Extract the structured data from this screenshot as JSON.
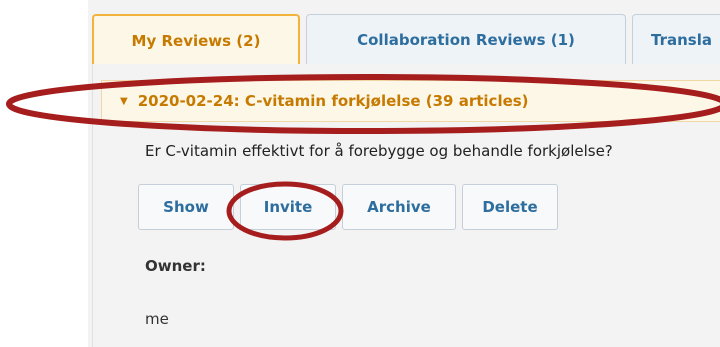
{
  "tabs": [
    {
      "label": "My Reviews (2)",
      "active": true
    },
    {
      "label": "Collaboration Reviews (1)",
      "active": false
    },
    {
      "label": "Transla",
      "active": false
    }
  ],
  "review": {
    "title": "2020-02-24: C-vitamin forkjølelse (39 articles)",
    "question": "Er C-vitamin effektivt for å forebygge og behandle forkjølelse?",
    "buttons": {
      "show": "Show",
      "invite": "Invite",
      "archive": "Archive",
      "delete": "Delete"
    },
    "owner_label": "Owner:",
    "owner_value": "me"
  },
  "annotations": {
    "highlight_color": "#a51d1d"
  },
  "colors": {
    "accent": "#c77a00",
    "link": "#2e6e9e",
    "active_tab_border": "#f2b33d"
  }
}
